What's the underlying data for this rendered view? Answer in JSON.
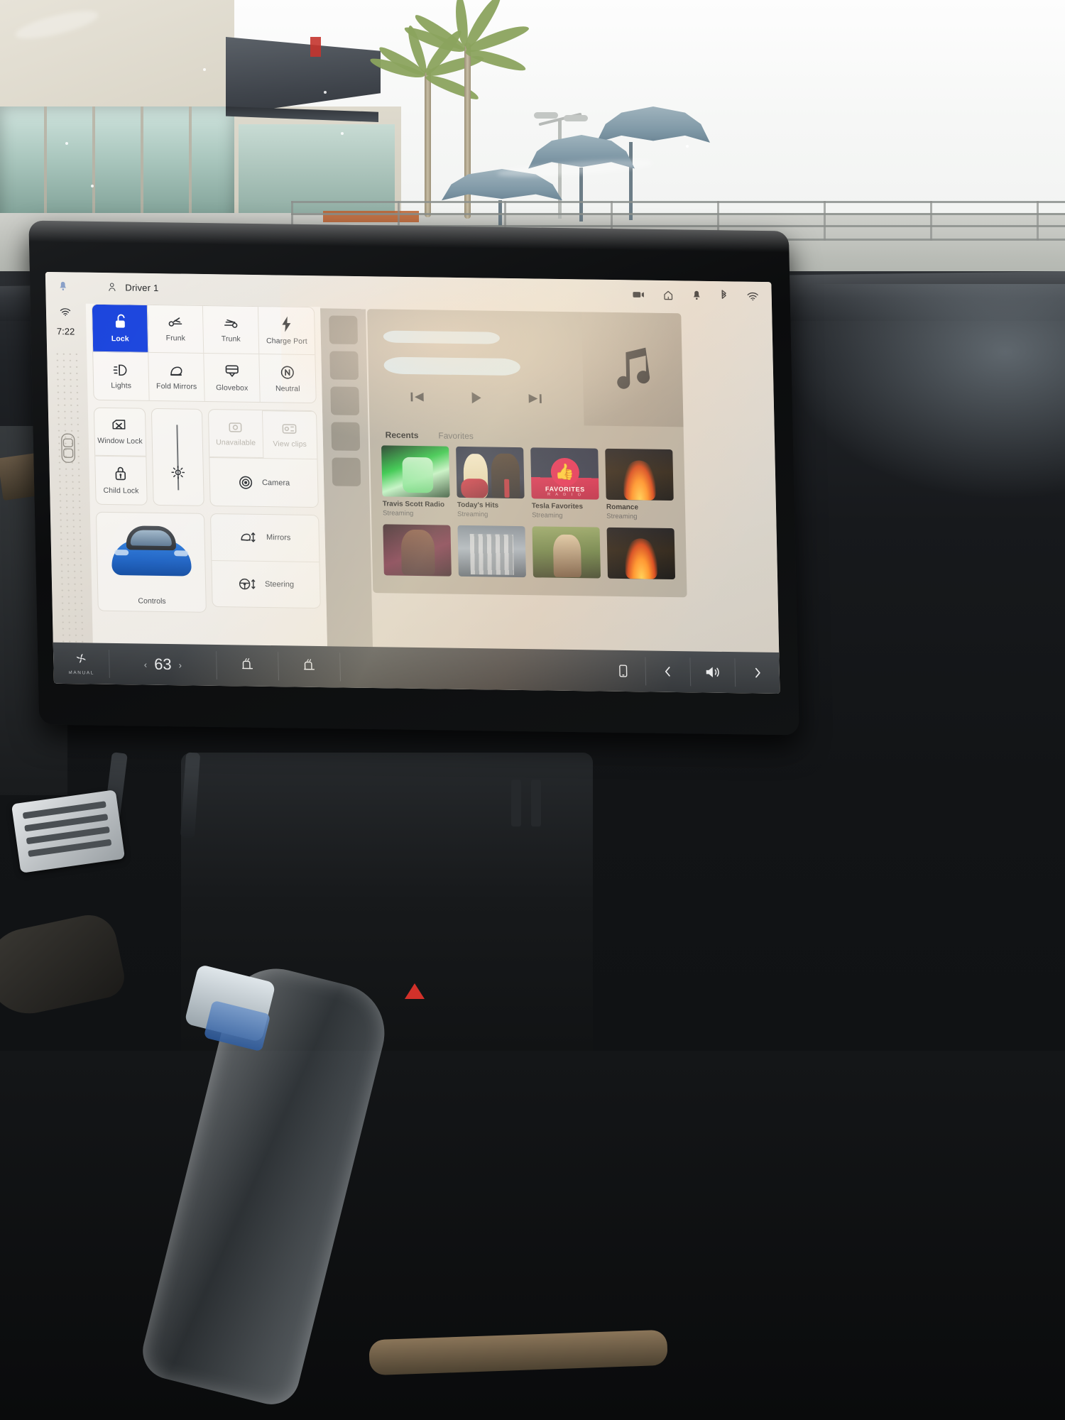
{
  "statusbar": {
    "bell_icon": "bell-icon",
    "profile_icon": "person-icon",
    "driver": "Driver 1",
    "dashcam_icon": "dashcam-icon",
    "home_icon": "home-icon",
    "notification_icon": "bell-icon",
    "bluetooth_icon": "bluetooth-icon",
    "wifi_icon": "wifi-icon"
  },
  "leftrail": {
    "wifi_icon": "wifi-icon",
    "time": "7:22",
    "car_icon": "car-top-view-icon"
  },
  "controls": {
    "row1": [
      {
        "label": "Lock",
        "icon": "unlock-icon",
        "active": true,
        "disabled": false
      },
      {
        "label": "Frunk",
        "icon": "frunk-icon",
        "active": false,
        "disabled": false
      },
      {
        "label": "Trunk",
        "icon": "trunk-icon",
        "active": false,
        "disabled": false
      },
      {
        "label": "Charge Port",
        "icon": "charge-bolt-icon",
        "active": false,
        "disabled": false
      }
    ],
    "row2": [
      {
        "label": "Lights",
        "icon": "headlight-icon",
        "active": false,
        "disabled": false
      },
      {
        "label": "Fold Mirrors",
        "icon": "mirror-icon",
        "active": false,
        "disabled": false
      },
      {
        "label": "Glovebox",
        "icon": "glovebox-icon",
        "active": false,
        "disabled": false
      },
      {
        "label": "Neutral",
        "icon": "neutral-n-icon",
        "active": false,
        "disabled": false
      }
    ],
    "window_lock": {
      "label": "Window Lock",
      "icon": "window-lock-icon"
    },
    "child_lock": {
      "label": "Child Lock",
      "icon": "child-lock-icon"
    },
    "brightness": {
      "icon": "brightness-sun-icon",
      "value": 62
    },
    "sentry": {
      "label": "Unavailable",
      "icon": "sentry-camera-icon",
      "disabled": true
    },
    "viewclips": {
      "label": "View clips",
      "icon": "clips-icon",
      "disabled": true
    },
    "camera": {
      "label": "Camera",
      "icon": "camera-icon"
    },
    "car_card": {
      "label": "Controls",
      "icon": "tesla-car-icon"
    },
    "mirrors": {
      "label": "Mirrors",
      "icon": "mirror-adjust-icon"
    },
    "steering": {
      "label": "Steering",
      "icon": "steering-wheel-icon"
    }
  },
  "media": {
    "track_title_redacted": "",
    "track_artist_redacted": "",
    "album_art_icon": "music-note-icon",
    "prev_icon": "previous-track-icon",
    "play_icon": "play-icon",
    "next_icon": "next-track-icon",
    "tabs": [
      {
        "label": "Recents",
        "selected": true
      },
      {
        "label": "Favorites",
        "selected": false
      }
    ],
    "cards_row1": [
      {
        "title": "Travis Scott Radio",
        "subtitle": "Streaming",
        "art": "a-travis"
      },
      {
        "title": "Today's Hits",
        "subtitle": "Streaming",
        "art": "a-hits"
      },
      {
        "title": "Tesla Favorites",
        "subtitle": "Streaming",
        "art": "a-fav",
        "badge_top": "FAVORITES",
        "badge_bottom": "R A D I O"
      },
      {
        "title": "Romance",
        "subtitle": "Streaming",
        "art": "a-romance"
      }
    ],
    "cards_row2": [
      {
        "title": "",
        "subtitle": "",
        "art": "a-meg"
      },
      {
        "title": "",
        "subtitle": "",
        "art": "a-arch"
      },
      {
        "title": "",
        "subtitle": "",
        "art": "a-country"
      },
      {
        "title": "",
        "subtitle": "",
        "art": "a-romance"
      }
    ]
  },
  "climate": {
    "fan_label": "MANUAL",
    "fan_icon": "fan-icon",
    "left_chevron": "‹",
    "temperature": "63",
    "right_chevron": "›",
    "seat_heat_left_icon": "seat-heater-icon",
    "seat_heat_right_icon": "seat-heater-icon",
    "phone_icon": "phone-icon",
    "volume_prev_icon": "chevron-left-icon",
    "volume_icon": "volume-icon",
    "volume_next_icon": "chevron-right-icon"
  },
  "colors": {
    "accent_blue": "#1a44dd",
    "panel_bg": "#f4f1ec",
    "media_bg": "#a8a194",
    "climate_bg": "#3e4246",
    "favorites_red": "#d31a46"
  }
}
